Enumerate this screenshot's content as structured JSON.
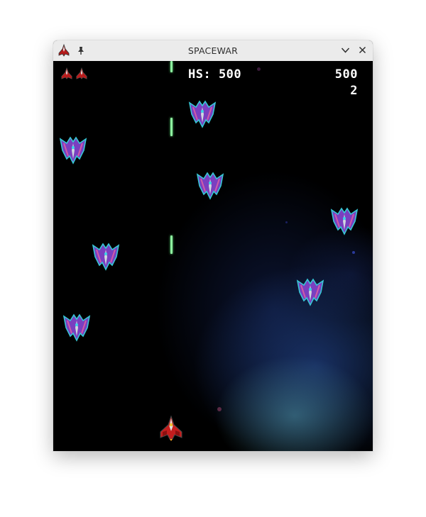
{
  "window": {
    "title": "SPACEWAR",
    "icons": [
      "app-ship-icon",
      "pin-icon",
      "chevron-down-icon",
      "close-icon"
    ]
  },
  "hud": {
    "high_score": "HS: 500",
    "score": "500",
    "level": "2",
    "lives": 2
  },
  "game": {
    "enemies": 7,
    "lasers": 3,
    "colors": {
      "background": "#000000",
      "laser": "#8ef2a0",
      "enemy_wing": "#7a3fc0",
      "enemy_edge": "#37c7d6",
      "player_hull": "#c41d1d"
    }
  }
}
